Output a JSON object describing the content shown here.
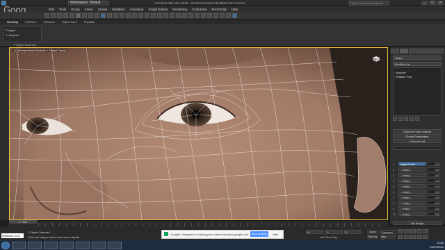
{
  "titlebar": {
    "workspace": "Workspace: Default",
    "title": "Autodesk 3ds Max 2015 - Student Version    CMod862 HD Cut.max",
    "search_placeholder": "Type a keyword or phrase",
    "win_buttons": [
      "_",
      "□",
      "×"
    ]
  },
  "watermark": "Goog",
  "menu": [
    "Edit",
    "Tools",
    "Group",
    "Views",
    "Create",
    "Modifiers",
    "Animation",
    "Graph Editors",
    "Rendering",
    "Customize",
    "MAXScript",
    "Help"
  ],
  "ribbon": {
    "tabs": [
      "Modeling",
      "Freeform",
      "Selection",
      "Object Paint",
      "Populate"
    ],
    "active_tab": "Modeling",
    "line1": "Polygon",
    "line2": "1: Morpher",
    "group_label": "Polygon Modeling"
  },
  "viewport": {
    "label": "[+] [Perspective] [Realistic + Edged Faces]"
  },
  "command_panel": {
    "object_name": "Head",
    "modifier_list": "Modifier List",
    "stack": [
      "Morpher",
      "Editable Poly"
    ],
    "rollouts": [
      "Channel Color Legend",
      "Global Parameters",
      "Channel List"
    ],
    "channels": [
      {
        "num": "1",
        "name": "tagwid blink",
        "value": "0.0",
        "active": true
      },
      {
        "num": "2",
        "name": "- empty -",
        "value": "0.0",
        "active": false
      },
      {
        "num": "3",
        "name": "- empty -",
        "value": "0.0",
        "active": false
      },
      {
        "num": "4",
        "name": "- empty -",
        "value": "0.0",
        "active": false
      },
      {
        "num": "5",
        "name": "- empty -",
        "value": "0.0",
        "active": false
      },
      {
        "num": "6",
        "name": "- empty -",
        "value": "0.0",
        "active": false
      },
      {
        "num": "7",
        "name": "- empty -",
        "value": "0.0",
        "active": false
      },
      {
        "num": "8",
        "name": "- empty -",
        "value": "0.0",
        "active": false
      },
      {
        "num": "9",
        "name": "- empty -",
        "value": "0.0",
        "active": false
      },
      {
        "num": "10",
        "name": "- empty -",
        "value": "0.0",
        "active": false
      }
    ],
    "list_range": "List Range"
  },
  "timeline": {
    "slider": "0 / 100"
  },
  "status": {
    "msg1": "1 Object Selected",
    "msg2": "Click and drag to select and move objects",
    "welcome": "Welcome to M",
    "coords": [
      "X:",
      "Y:",
      "Z:"
    ],
    "autokey": "Auto Key",
    "setkey": "Set Key",
    "selected": "Selected",
    "keyfilters": "Key Filters...",
    "addtimetag": "Add Time Tag"
  },
  "hangouts": {
    "text": "Google+ Hangouts is sharing your screen with plus.google.com.",
    "stop": "Stop sharing",
    "hide": "Hide"
  },
  "tray": {
    "time": "12:52",
    "date": "14/07/2014"
  }
}
